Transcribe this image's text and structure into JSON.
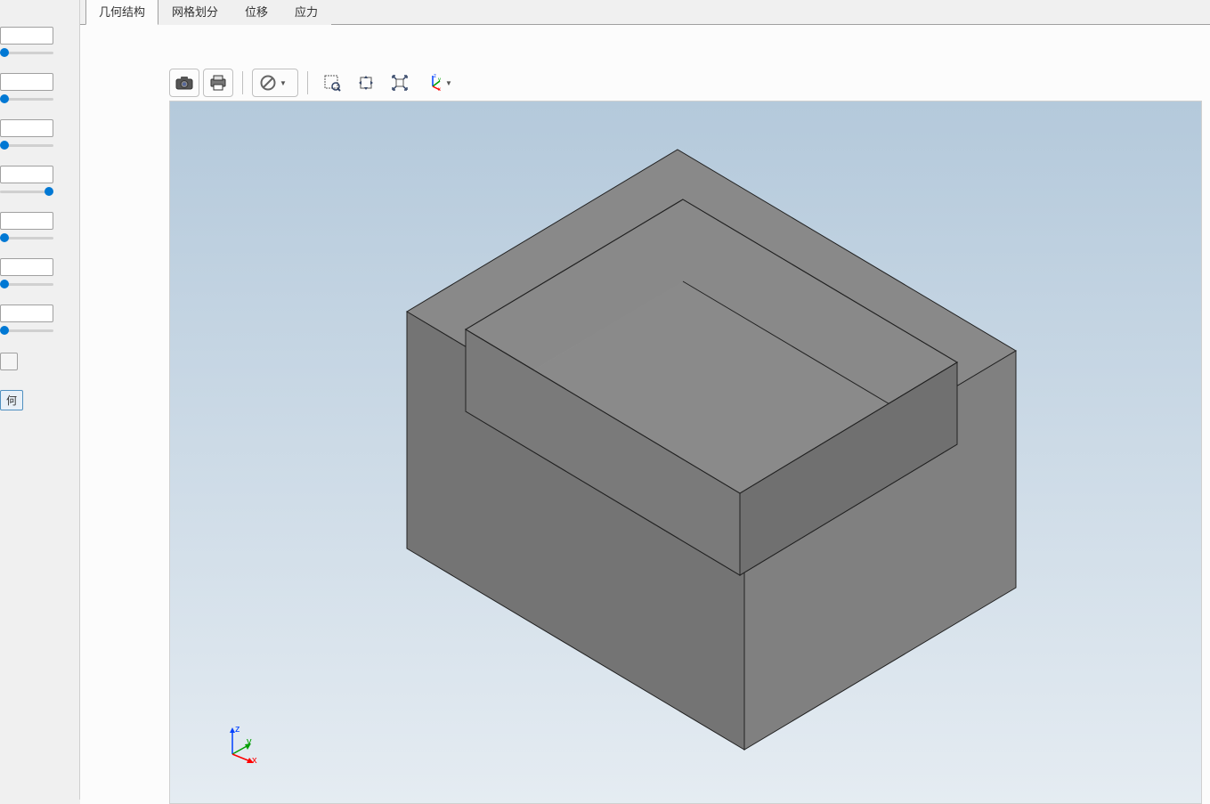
{
  "tabs": {
    "geometry": "几何结构",
    "mesh": "网格划分",
    "displacement": "位移",
    "stress": "应力"
  },
  "left_panel": {
    "button_suffix": "何"
  },
  "axis": {
    "x": "x",
    "y": "y",
    "z": "z"
  },
  "toolbar_icons": {
    "camera": "camera",
    "print": "print",
    "no_entry": "no-entry",
    "zoom_select": "zoom-select",
    "pan": "pan",
    "fit": "fit",
    "coords": "coords"
  }
}
